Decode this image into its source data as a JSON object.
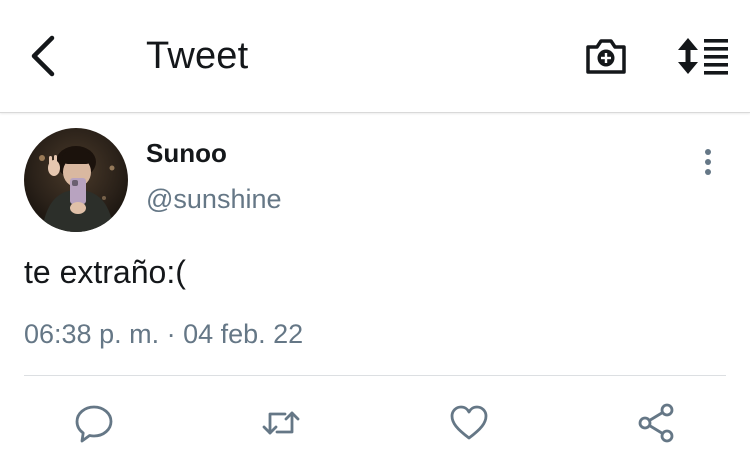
{
  "header": {
    "title": "Tweet",
    "back_icon": "chevron-left-icon",
    "camera_icon": "camera-plus-icon",
    "sort_icon": "sort-lines-icon"
  },
  "tweet": {
    "author_name": "Sunoo",
    "author_handle": "@sunshine",
    "text": "te extraño:(",
    "timestamp": "06:38 p. m. · 04 feb. 22",
    "more_icon": "more-vertical-icon"
  },
  "actions": [
    {
      "name": "reply",
      "icon": "reply-bubble-icon"
    },
    {
      "name": "retweet",
      "icon": "retweet-icon"
    },
    {
      "name": "like",
      "icon": "heart-icon"
    },
    {
      "name": "share",
      "icon": "share-nodes-icon"
    }
  ],
  "colors": {
    "text_primary": "#14171a",
    "text_secondary": "#657786",
    "icon_gray": "#657786",
    "divider": "#dcdfe2",
    "background": "#ffffff"
  }
}
